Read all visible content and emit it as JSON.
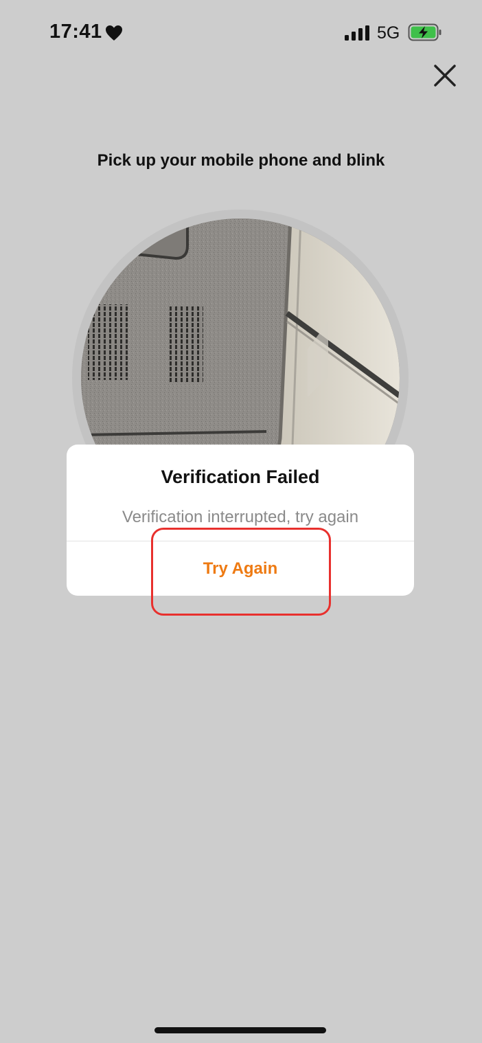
{
  "status_bar": {
    "time": "17:41",
    "network": "5G",
    "icons": [
      "heart-icon",
      "signal-icon",
      "battery-charging-icon"
    ],
    "battery_color": "#3fc04a"
  },
  "close_icon": "close-icon",
  "instruction": "Pick up your mobile phone and blink",
  "camera_preview": "camera-feed",
  "dialog": {
    "title": "Verification Failed",
    "message": "Verification interrupted, try again",
    "button_label": "Try Again"
  },
  "colors": {
    "background": "#cdcdcd",
    "accent": "#ee7a12",
    "highlight": "#e8302d"
  }
}
